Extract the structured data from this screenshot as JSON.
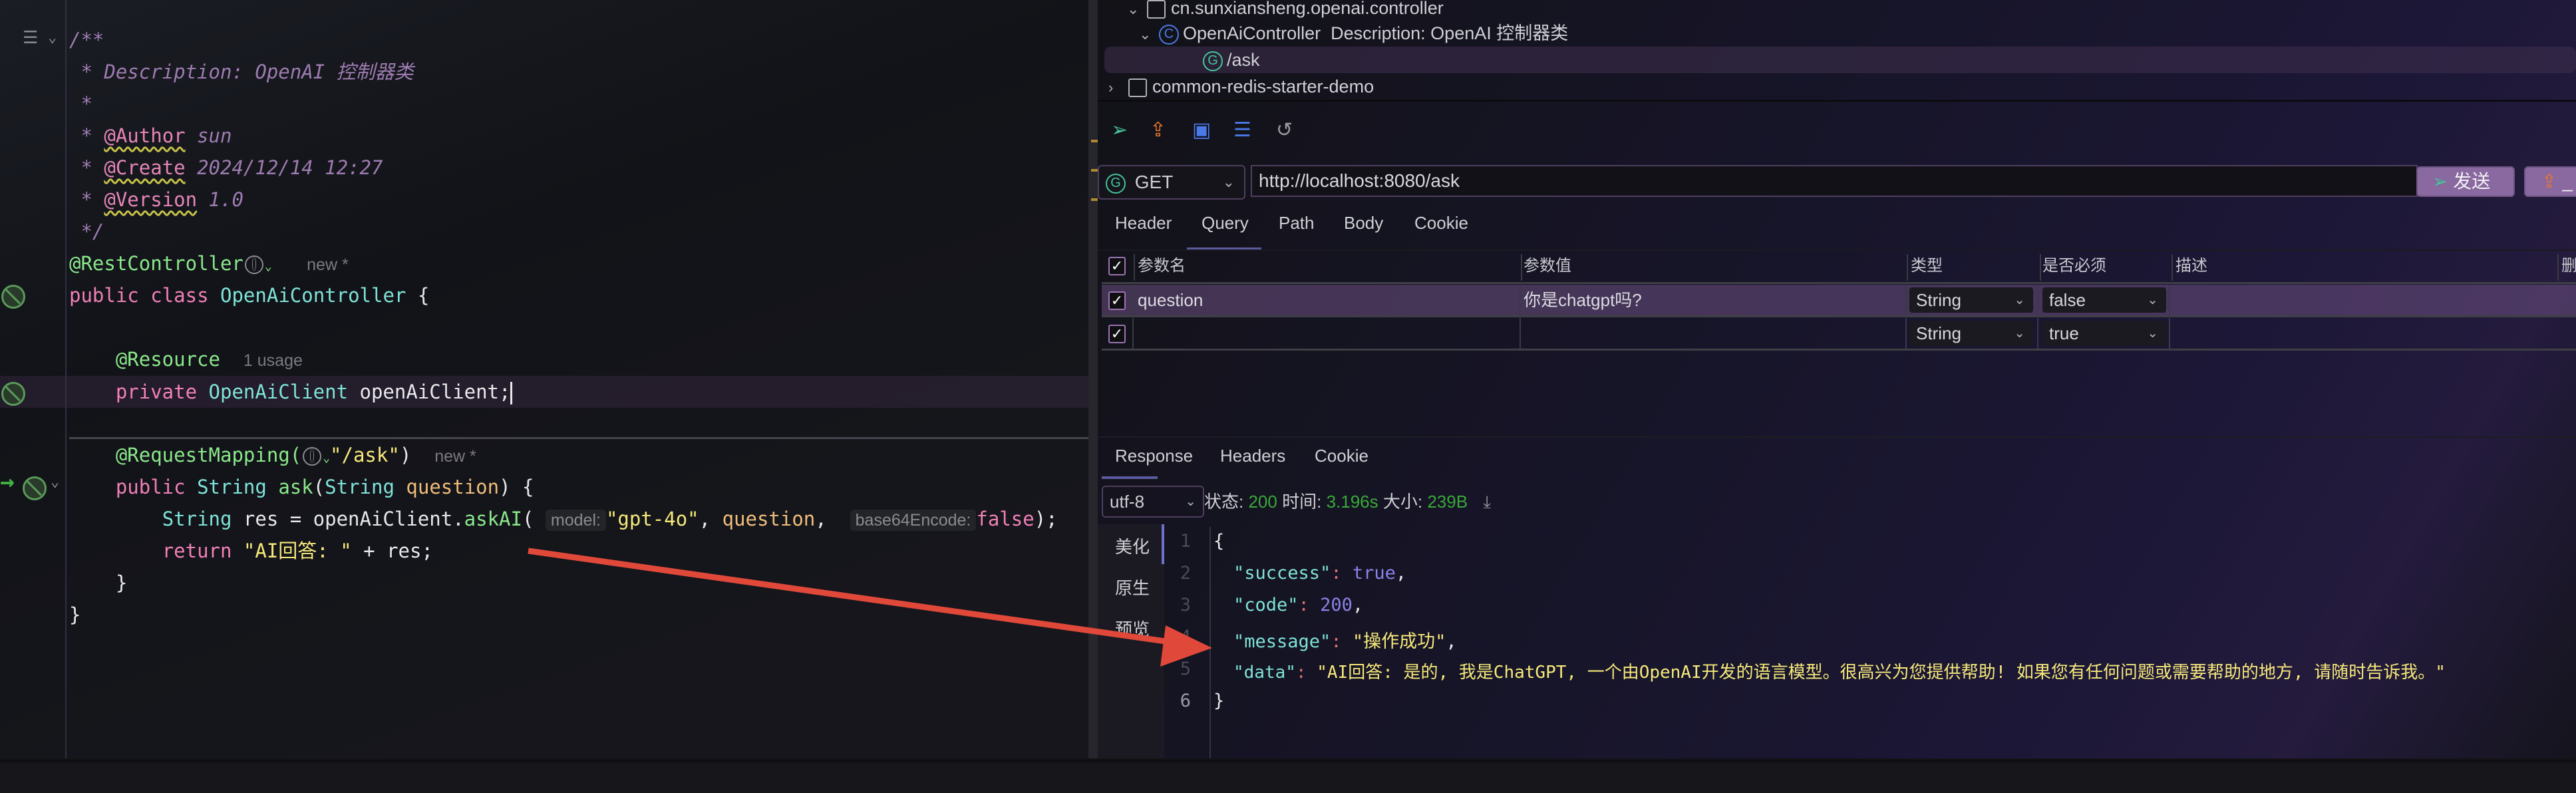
{
  "editor": {
    "lines": {
      "c1": "/**",
      "c2": " * Description: OpenAI 控制器类",
      "c3": " *",
      "c4_star": " * ",
      "c4_tag": "@Author",
      "c4_val": " sun",
      "c5_star": " * ",
      "c5_tag": "@Create",
      "c5_val": " 2024/12/14 12:27",
      "c6_star": " * ",
      "c6_tag": "@Version",
      "c6_val": " 1.0",
      "c7": " */",
      "ann_rest": "@RestController",
      "meta_new": "new *",
      "kw_public": "public",
      "kw_class": "class",
      "class_name": "OpenAiController",
      "brace_open": " {",
      "ann_resource": "@Resource",
      "meta_usage": "1 usage",
      "kw_private": "private",
      "type_client": "OpenAiClient",
      "var_client": " openAiClient;",
      "ann_mapping": "@RequestMapping(",
      "mapping_path": "\"/ask\"",
      "mapping_close": ")",
      "type_string": "String",
      "method_ask": "ask",
      "paren_open": "(",
      "param_question": "question",
      "sig_close": ") {",
      "res_decl": " res = openAiClient.",
      "call_askai": "askAI",
      "hint_model": "model:",
      "str_model": "\"gpt-4o\"",
      "comma": ", ",
      "arg_question": "question",
      "hint_base64": "base64Encode:",
      "kw_false": "false",
      "call_close": ");",
      "kw_return": "return",
      "str_answer": "\"AI回答: \"",
      "concat": " + res;",
      "close_method": "}",
      "close_class": "}"
    }
  },
  "tree": {
    "package": "cn.sunxiansheng.openai.controller",
    "class_name": "OpenAiController",
    "class_desc": "Description: OpenAI 控制器类",
    "class_badge": "C",
    "endpoint_badge": "G",
    "endpoint": "/ask",
    "module": "common-redis-starter-demo"
  },
  "toolbar": {
    "icons": [
      "send-icon",
      "export-icon",
      "save-icon",
      "doc-icon",
      "history-icon"
    ]
  },
  "request": {
    "method_badge": "G",
    "method": "GET",
    "url": "http://localhost:8080/ask",
    "send_label": "发送",
    "export_label": "_"
  },
  "request_tabs": [
    "Header",
    "Query",
    "Path",
    "Body",
    "Cookie"
  ],
  "active_request_tab": "Query",
  "params_table": {
    "headers": [
      "参数名",
      "参数值",
      "类型",
      "是否必须",
      "描述",
      "删"
    ],
    "rows": [
      {
        "checked": true,
        "name": "question",
        "value": "你是chatgpt吗?",
        "type": "String",
        "required": "false",
        "desc": ""
      },
      {
        "checked": true,
        "name": "",
        "value": "",
        "type": "String",
        "required": "true",
        "desc": ""
      }
    ]
  },
  "response_tabs": [
    "Response",
    "Headers",
    "Cookie"
  ],
  "active_response_tab": "Response",
  "response_meta": {
    "encoding": "utf-8",
    "status_label": "状态:",
    "status": "200",
    "time_label": "时间:",
    "time": "3.196s",
    "size_label": "大小:",
    "size": "239B"
  },
  "view_modes": [
    "美化",
    "原生",
    "预览"
  ],
  "active_view_mode": "美化",
  "response_body": {
    "line_numbers": [
      "1",
      "2",
      "3",
      "4",
      "5",
      "6"
    ],
    "open": "{",
    "close": "}",
    "success_key": "\"success\"",
    "success_val": "true",
    "code_key": "\"code\"",
    "code_val": "200",
    "message_key": "\"message\"",
    "message_val": "\"操作成功\"",
    "data_key": "\"data\"",
    "data_val": "\"AI回答: 是的, 我是ChatGPT, 一个由OpenAI开发的语言模型。很高兴为您提供帮助! 如果您有任何问题或需要帮助的地方, 请随时告诉我。\"",
    "colon": ": ",
    "comma": ","
  },
  "colors": {
    "accent_purple": "#8a68a0",
    "status_green": "#3aa83a",
    "annotation_arrow": "#e0483a"
  }
}
